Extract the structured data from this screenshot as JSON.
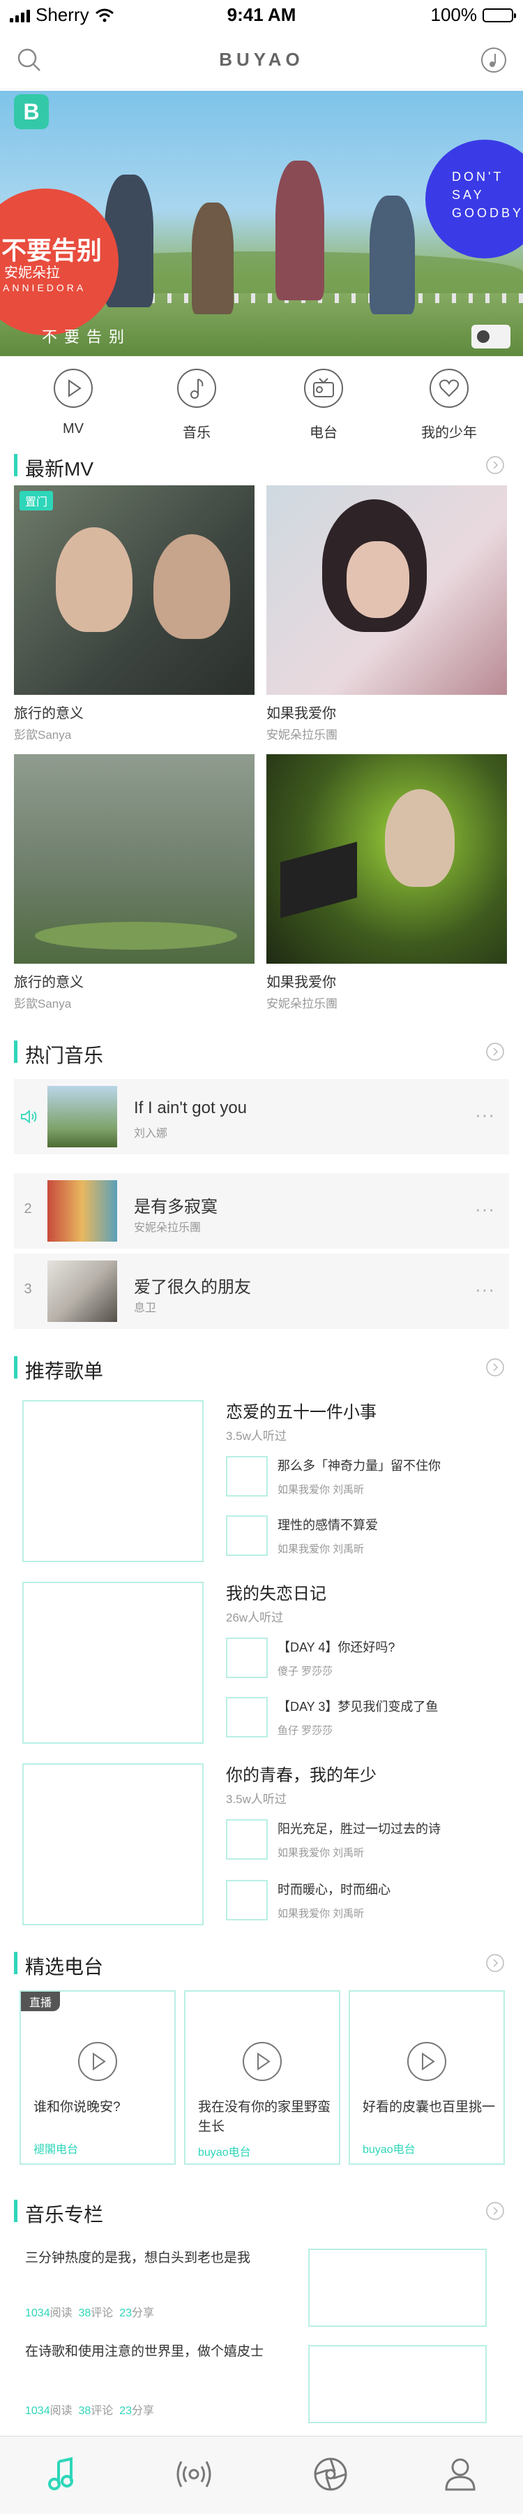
{
  "status_bar": {
    "carrier": "Sherry",
    "time": "9:41 AM",
    "battery": "100%"
  },
  "header": {
    "title": "BUYAO"
  },
  "banner": {
    "badge": "B",
    "red_title": "不要告别",
    "red_subtitle": "安妮朵拉",
    "red_english": "ANNIEDORA",
    "blue_text": [
      "DON'T",
      "SAY",
      "GOODBY"
    ],
    "subtitle": "不要告别"
  },
  "quick_nav": [
    {
      "label": "MV",
      "icon": "play-icon"
    },
    {
      "label": "音乐",
      "icon": "music-note-icon"
    },
    {
      "label": "电台",
      "icon": "radio-icon"
    },
    {
      "label": "我的少年",
      "icon": "heart-icon"
    }
  ],
  "sections": {
    "mv": "最新MV",
    "hot_music": "热门音乐",
    "playlists": "推荐歌单",
    "radio": "精选电台",
    "columns": "音乐专栏"
  },
  "mv_list": [
    {
      "title": "旅行的意义",
      "artist": "彭歆Sanya",
      "tag": "置门"
    },
    {
      "title": "如果我爱你",
      "artist": "安妮朵拉乐團"
    },
    {
      "title": "旅行的意义",
      "artist": "彭歆Sanya"
    },
    {
      "title": "如果我爱你",
      "artist": "安妮朵拉乐團"
    }
  ],
  "songs": [
    {
      "rank": "",
      "title": "If I ain't got you",
      "artist": "刘入娜"
    },
    {
      "rank": "2",
      "title": "是有多寂寞",
      "artist": "安妮朵拉乐團"
    },
    {
      "rank": "3",
      "title": "爱了很久的朋友",
      "artist": "息卫"
    }
  ],
  "more_dots": "···",
  "playlists": [
    {
      "title": "恋爱的五十一件小事",
      "count": "3.5w人听过",
      "tracks": [
        {
          "name": "那么多「神奇力量」留不住你",
          "artist": "如果我爱你 刘禹昕"
        },
        {
          "name": "理性的感情不算爱",
          "artist": "如果我爱你 刘禹昕"
        }
      ]
    },
    {
      "title": "我的失恋日记",
      "count": "26w人听过",
      "tracks": [
        {
          "name": "【DAY 4】你还好吗?",
          "artist": "傻子 罗莎莎"
        },
        {
          "name": "【DAY 3】梦见我们变成了鱼",
          "artist": "鱼仔 罗莎莎"
        }
      ]
    },
    {
      "title": "你的青春，我的年少",
      "count": "3.5w人听过",
      "tracks": [
        {
          "name": "阳光充足，胜过一切过去的诗",
          "artist": "如果我爱你 刘禹昕"
        },
        {
          "name": "时而暖心，时而细心",
          "artist": "如果我爱你 刘禹昕"
        }
      ]
    }
  ],
  "radio": [
    {
      "title": "谁和你说晚安?",
      "source": "褪閣电台",
      "live": "直播"
    },
    {
      "title": "我在没有你的家里野蛮生长",
      "source": "buyao电台"
    },
    {
      "title": "好看的皮囊也百里挑一",
      "source": "buyao电台"
    }
  ],
  "columns": [
    {
      "title": "三分钟热度的是我，想白头到老也是我",
      "reads": "1034",
      "comments": "38",
      "shares": "23"
    },
    {
      "title": "在诗歌和使用注意的世界里，做个嬉皮士",
      "reads": "1034",
      "comments": "38",
      "shares": "23"
    }
  ],
  "column_labels": {
    "reads": "阅读",
    "comments": "评论",
    "shares": "分享"
  },
  "tab_bar": [
    "music-tab-icon",
    "radio-tab-icon",
    "discover-tab-icon",
    "profile-tab-icon"
  ],
  "colors": {
    "accent": "#2ed6b9",
    "card_border": "#b9efe4"
  }
}
